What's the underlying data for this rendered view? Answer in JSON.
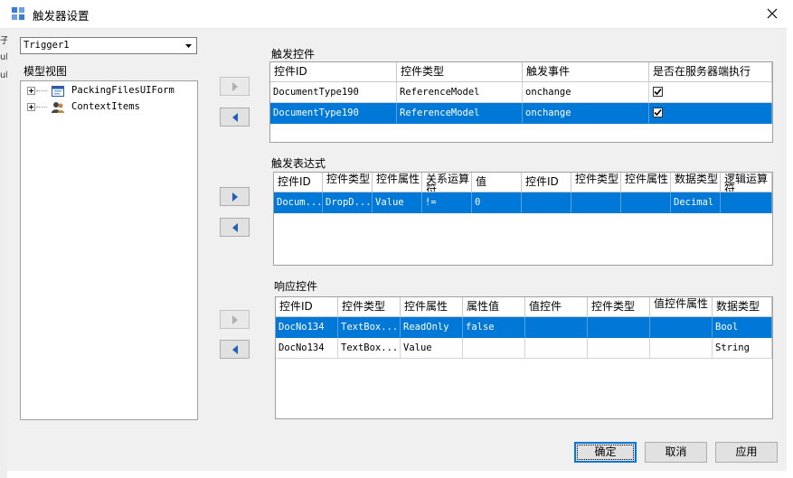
{
  "window": {
    "title": "触发器设置",
    "bg_strip_chars": [
      "子",
      "ub",
      "ub"
    ]
  },
  "trigger_select": {
    "value": "Trigger1"
  },
  "model_view": {
    "label": "模型视图",
    "nodes": [
      {
        "label": "PackingFilesUIForm",
        "icon": "form-icon"
      },
      {
        "label": "ContextItems",
        "icon": "users-icon"
      }
    ]
  },
  "trigger_controls": {
    "label": "触发控件",
    "columns": [
      "控件ID",
      "控件类型",
      "触发事件",
      "是否在服务器端执行"
    ],
    "rows": [
      {
        "cells": [
          "DocumentType190",
          "ReferenceModel",
          "onchange"
        ],
        "server_exec": true,
        "selected": false
      },
      {
        "cells": [
          "DocumentType190",
          "ReferenceModel",
          "onchange"
        ],
        "server_exec": true,
        "selected": true
      }
    ]
  },
  "trigger_expression": {
    "label": "触发表达式",
    "columns": [
      "控件ID",
      "控件类型",
      "控件属性",
      "关系运算符",
      "值",
      "控件ID",
      "控件类型",
      "控件属性",
      "数据类型",
      "逻辑运算符"
    ],
    "rows": [
      {
        "cells": [
          "Docum...",
          "DropD...",
          "Value",
          "!=",
          "0",
          "",
          "",
          "",
          "Decimal",
          ""
        ],
        "selected": true
      }
    ]
  },
  "response_controls": {
    "label": "响应控件",
    "columns": [
      "控件ID",
      "控件类型",
      "控件属性",
      "属性值",
      "值控件",
      "控件类型",
      "值控件属性",
      "数据类型"
    ],
    "rows": [
      {
        "cells": [
          "DocNo134",
          "TextBox...",
          "ReadOnly",
          "false",
          "",
          "",
          "",
          "Bool"
        ],
        "selected": true
      },
      {
        "cells": [
          "DocNo134",
          "TextBox...",
          "Value",
          "",
          "",
          "",
          "",
          "String"
        ],
        "selected": false
      }
    ]
  },
  "buttons": {
    "ok": "确定",
    "cancel": "取消",
    "apply": "应用"
  },
  "colors": {
    "selection": "#0078d7",
    "dialog_bg": "#f0f0f0"
  }
}
